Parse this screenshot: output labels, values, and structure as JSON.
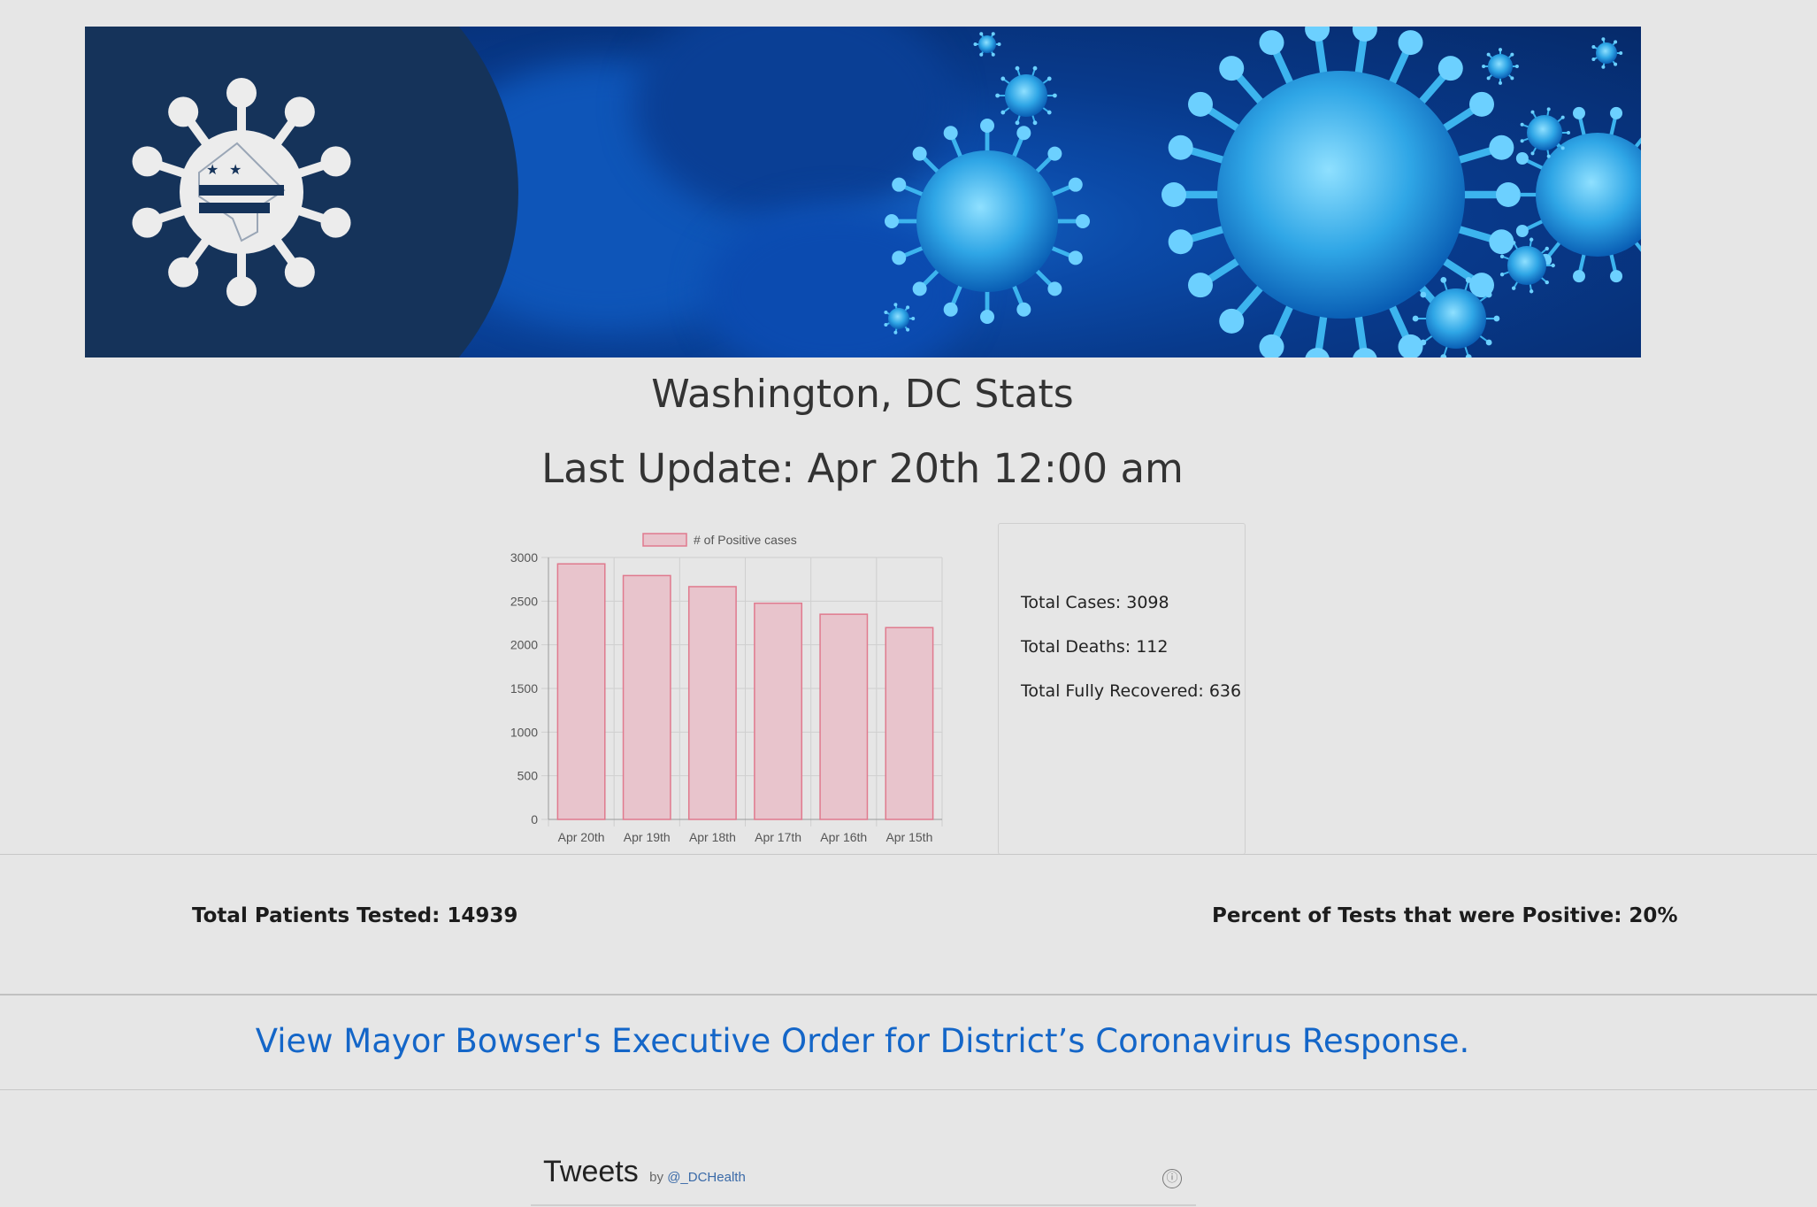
{
  "banner": {
    "logo_icon": "dc-virus-logo-icon",
    "image": "coronavirus-illustration"
  },
  "header": {
    "title": "Washington, DC Stats",
    "last_update": "Last Update: Apr 20th 12:00 am"
  },
  "chart_data": {
    "type": "bar",
    "legend": [
      "# of Positive cases"
    ],
    "categories": [
      "Apr 20th",
      "Apr 19th",
      "Apr 18th",
      "Apr 17th",
      "Apr 16th",
      "Apr 15th"
    ],
    "series": [
      {
        "name": "# of Positive cases",
        "values": [
          2927,
          2793,
          2666,
          2476,
          2350,
          2197
        ]
      }
    ],
    "y_ticks": [
      "0",
      "500",
      "1000",
      "1500",
      "2000",
      "2500",
      "3000"
    ],
    "ylim": [
      0,
      3000
    ],
    "grid": true,
    "legend_position": "top",
    "colors": {
      "fill": "#e8c4cc",
      "stroke": "#e07a8e"
    }
  },
  "summary": {
    "total_cases": "Total Cases: 3098",
    "total_deaths": "Total Deaths: 112",
    "total_recovered": "Total Fully Recovered: 636"
  },
  "stats": {
    "patients_tested": "Total Patients Tested: 14939",
    "percent_positive": "Percent of Tests that were Positive: 20%"
  },
  "links": {
    "executive_order": "View Mayor Bowser's Executive Order for District’s Coronavirus Response."
  },
  "tweets": {
    "title": "Tweets",
    "by": "by",
    "handle": "@_DCHealth",
    "info_icon": "ⓘ"
  },
  "colors": {
    "background": "#e6e6e6",
    "link": "#1466c8",
    "banner_panel": "#15335a"
  }
}
